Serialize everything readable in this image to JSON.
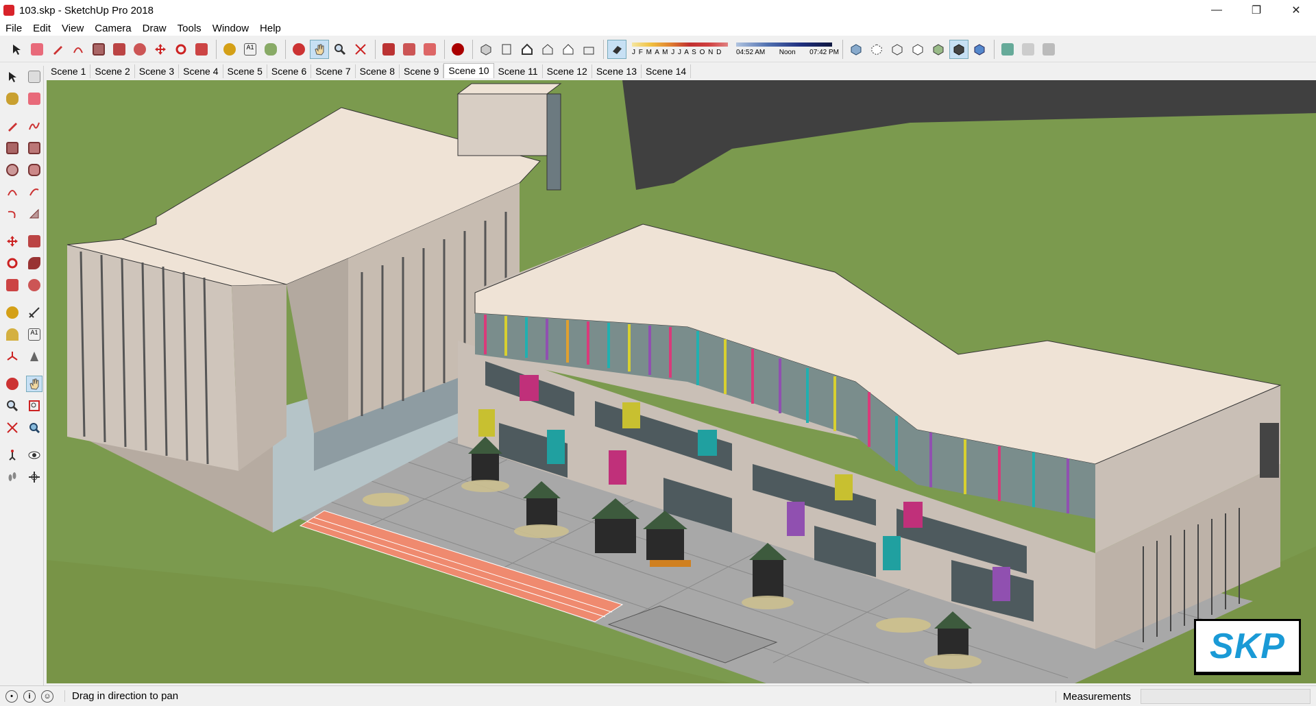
{
  "window": {
    "title": "103.skp - SketchUp Pro 2018",
    "controls": [
      "—",
      "❐",
      "✕"
    ]
  },
  "menu": [
    "File",
    "Edit",
    "View",
    "Camera",
    "Draw",
    "Tools",
    "Window",
    "Help"
  ],
  "shadow": {
    "months": "J F M A M J J A S O N D",
    "time_start": "04:52 AM",
    "time_mid": "Noon",
    "time_end": "07:42 PM"
  },
  "scenes": [
    "Scene 1",
    "Scene 2",
    "Scene 3",
    "Scene 4",
    "Scene 5",
    "Scene 6",
    "Scene 7",
    "Scene 8",
    "Scene 9",
    "Scene 10",
    "Scene 11",
    "Scene 12",
    "Scene 13",
    "Scene 14"
  ],
  "active_scene": "Scene 10",
  "status": {
    "message": "Drag in direction to pan",
    "measurements_label": "Measurements",
    "measurements_value": ""
  },
  "badge": "SKP",
  "colors": {
    "ground": "#7b9a4e",
    "road": "#404040",
    "wall": "#c9bfb6",
    "roof": "#efe3d6",
    "track": "#ef8a6f"
  }
}
